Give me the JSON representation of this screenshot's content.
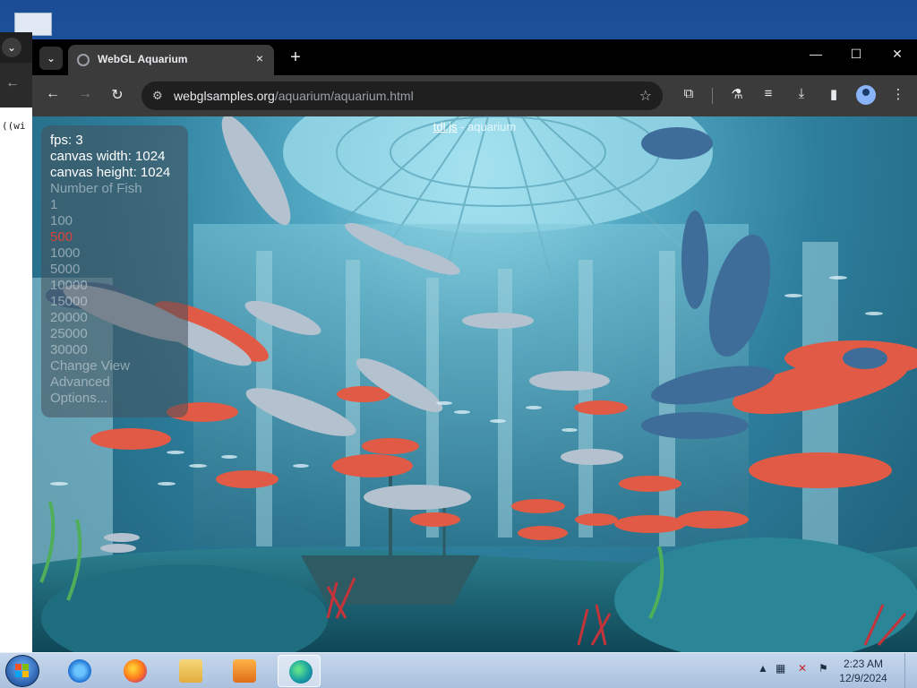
{
  "browser": {
    "tab_title": "WebGL Aquarium",
    "tab_close": "×",
    "new_tab": "+",
    "url_host": "webglsamples.org",
    "url_path": "/aquarium/aquarium.html",
    "icons": {
      "tab_search": "chevron-down-icon",
      "back": "arrow-left-icon",
      "forward": "arrow-right-icon",
      "reload": "reload-icon",
      "site_info": "tune-icon",
      "bookmark": "star-icon",
      "extensions": "puzzle-icon",
      "labs": "flask-icon",
      "media": "playlist-icon",
      "downloads": "download-icon",
      "side_panel": "side-panel-icon",
      "profile": "profile-icon",
      "menu": "kebab-menu-icon"
    },
    "window_controls": {
      "minimize": "—",
      "maximize": "☐",
      "close": "✕"
    }
  },
  "aquarium": {
    "header_link": "tdl.js",
    "header_rest": " - aquarium",
    "fps": "fps: 3",
    "canvas_width": "canvas width: 1024",
    "canvas_height": "canvas height: 1024",
    "number_of_fish_label": "Number of Fish",
    "fish_options": [
      "1",
      "100",
      "500",
      "1000",
      "5000",
      "10000",
      "15000",
      "20000",
      "25000",
      "30000"
    ],
    "selected_fish_option": "500",
    "change_view": "Change View",
    "advanced": "Advanced",
    "options": "Options..."
  },
  "background_window": {
    "code_snippet": "((wi"
  },
  "taskbar": {
    "apps": [
      "Internet Explorer",
      "Firefox",
      "File Explorer",
      "Media Player",
      "Edge"
    ],
    "active_app": "Edge",
    "clock_time": "2:23 AM",
    "clock_date": "12/9/2024",
    "tray_expand": "▲"
  },
  "colors": {
    "chrome_bg": "#202124",
    "tab_active": "#3b3b3b",
    "selected_option": "#d8453a",
    "taskbar": "#b8cde6"
  }
}
